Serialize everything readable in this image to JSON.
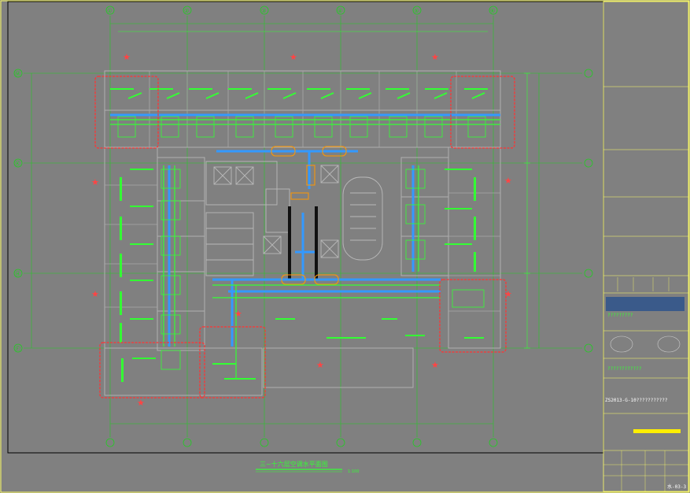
{
  "drawing": {
    "grid_columns": [
      "①",
      "②",
      "③",
      "④",
      "⑤",
      "⑥"
    ],
    "grid_rows": [
      "Ⓜ",
      "Ⓚ",
      "Ⓗ",
      "Ⓕ"
    ],
    "drawing_title": "三~十六层空调水平面图",
    "drawing_scale": "1:100"
  },
  "title_block": {
    "project_code": "ZS2013-G-10???????????",
    "project_name_line": "????????????",
    "company_line": "?????????",
    "sheet_number": "水-03-3"
  },
  "colors": {
    "background": "#808080",
    "frame": "#ffff66",
    "grid_line": "#22cc22",
    "pipe_green": "#33ff33",
    "duct_blue": "#3399ff",
    "wall": "#b0b0b0",
    "highlight": "#ff3333",
    "star": "#ff4444"
  }
}
